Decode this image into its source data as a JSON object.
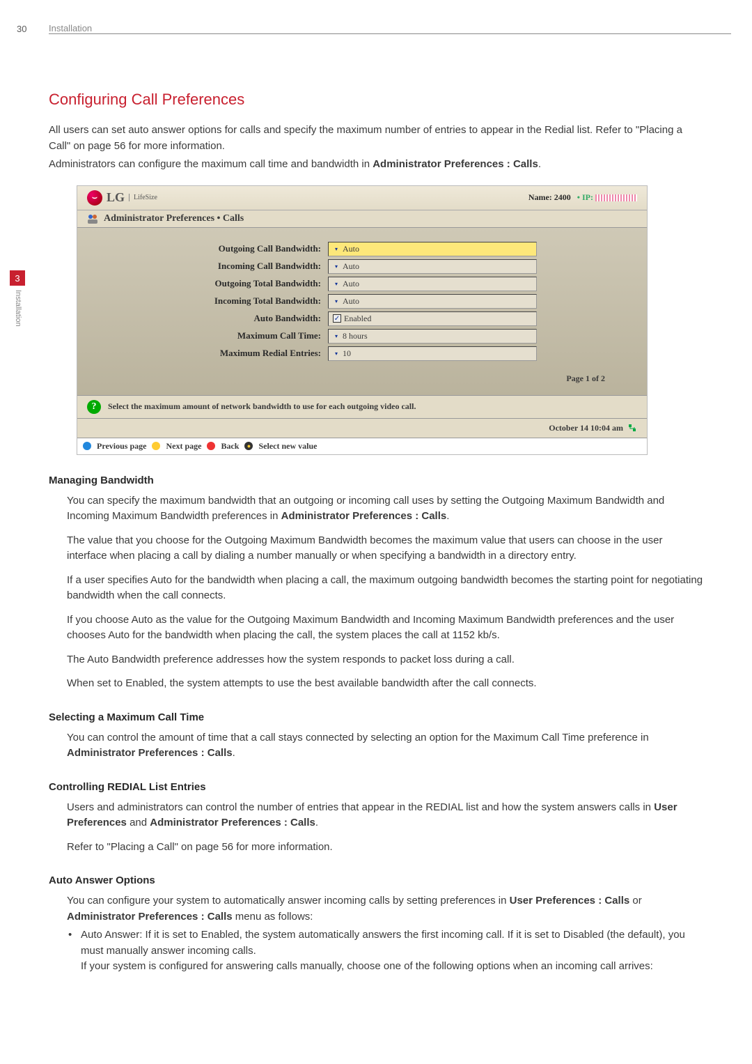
{
  "page_header": {
    "page_number": "30",
    "section": "Installation"
  },
  "side": {
    "chapter": "3",
    "label": "Installation"
  },
  "title": "Configuring Call Preferences",
  "intro": {
    "p1": "All users can set auto answer options for calls and specify the maximum number of entries to appear in the Redial list. Refer to \"Placing a Call\" on page 56 for more information.",
    "p2_pre": "Administrators can configure the maximum call time and bandwidth in ",
    "p2_bold": "Administrator Preferences : Calls",
    "p2_post": "."
  },
  "screenshot": {
    "logo": "LG",
    "sublogo": "LifeSize",
    "name_label": "Name: 2400",
    "ip_label": "• IP:",
    "breadcrumb": "Administrator Preferences • Calls",
    "rows": [
      {
        "label": "Outgoing Call Bandwidth:",
        "value": "Auto",
        "type": "select",
        "selected": true
      },
      {
        "label": "Incoming Call Bandwidth:",
        "value": "Auto",
        "type": "select"
      },
      {
        "label": "Outgoing Total Bandwidth:",
        "value": "Auto",
        "type": "select"
      },
      {
        "label": "Incoming Total Bandwidth:",
        "value": "Auto",
        "type": "select"
      },
      {
        "label": "Auto Bandwidth:",
        "value": "Enabled",
        "type": "check"
      },
      {
        "label": "Maximum Call Time:",
        "value": "8 hours",
        "type": "select"
      },
      {
        "label": "Maximum Redial Entries:",
        "value": "10",
        "type": "select"
      }
    ],
    "page_info": "Page 1 of 2",
    "hint": "Select the maximum amount of network bandwidth to use for each outgoing video call.",
    "status": "October 14   10:04 am",
    "footer": {
      "prev": "Previous page",
      "next": "Next page",
      "back": "Back",
      "select": "Select new value"
    }
  },
  "managing_bandwidth": {
    "heading": "Managing Bandwidth",
    "p1_pre": "You can specify the maximum bandwidth that an outgoing or incoming call uses by setting the Outgoing Maximum Bandwidth and Incoming Maximum Bandwidth preferences in ",
    "p1_bold": "Administrator Preferences : Calls",
    "p1_post": ".",
    "p2": "The value that you choose for the Outgoing Maximum Bandwidth becomes the maximum value that users can choose in the user interface when placing a call by dialing a number manually or when specifying a bandwidth in a directory entry.",
    "p3": "If a user specifies Auto for the bandwidth when placing a call, the maximum outgoing bandwidth becomes the starting point for negotiating bandwidth when the call connects.",
    "p4": "If you choose Auto as the value for the Outgoing Maximum Bandwidth and Incoming Maximum Bandwidth preferences and the user chooses Auto for the bandwidth when placing the call, the system places the call at 1152 kb/s.",
    "p5": "The Auto Bandwidth preference addresses how the system responds to packet loss during a call.",
    "p6": "When set to Enabled, the system attempts to use the best available bandwidth after the call connects."
  },
  "max_call_time": {
    "heading": "Selecting a Maximum Call Time",
    "p1_pre": "You can control the amount of time that a call stays connected by selecting an option for the Maximum Call Time preference in ",
    "p1_bold": "Administrator Preferences : Calls",
    "p1_post": "."
  },
  "redial": {
    "heading": "Controlling REDIAL List Entries",
    "p1_pre": "Users and administrators can control the number of entries that appear in the REDIAL list and how the system answers calls in ",
    "p1_bold1": "User Preferences",
    "p1_mid": " and ",
    "p1_bold2": "Administrator Preferences : Calls",
    "p1_post": ".",
    "p2": "Refer to \"Placing a Call\" on page 56 for more information."
  },
  "auto_answer": {
    "heading": "Auto Answer Options",
    "p1_pre": "You can configure your system to automatically answer incoming calls by setting preferences in ",
    "p1_bold1": "User Preferences : Calls",
    "p1_mid": " or ",
    "p1_bold2": "Administrator Preferences : Calls",
    "p1_post": " menu as follows:",
    "bullet1a": "Auto Answer: If it is set to Enabled, the system automatically answers the first incoming call. If it is set to Disabled (the default), you must manually answer incoming calls.",
    "bullet1b": "If your system is configured for answering calls manually, choose one of the following options when an incoming call arrives:"
  }
}
